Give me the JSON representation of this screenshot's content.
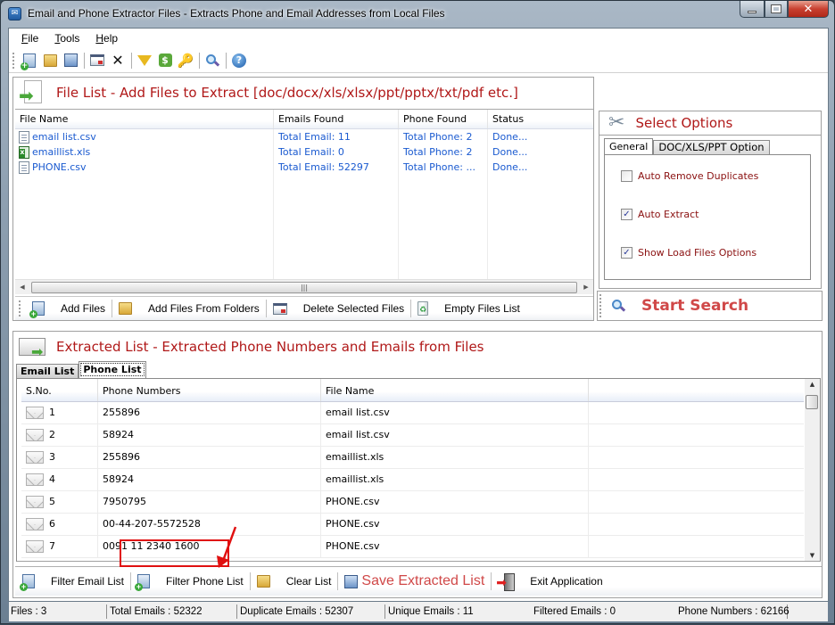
{
  "window": {
    "title": "Email and Phone Extractor Files  -  Extracts Phone and Email Addresses from Local Files",
    "controls": {
      "minimize": "–",
      "maximize": "□",
      "close": "✕"
    }
  },
  "menu": [
    {
      "label": "File",
      "mnemonic": "F"
    },
    {
      "label": "Tools",
      "mnemonic": "T"
    },
    {
      "label": "Help",
      "mnemonic": "H"
    }
  ],
  "toolbar": [
    {
      "icon": "add-files-icon"
    },
    {
      "icon": "add-folder-icon"
    },
    {
      "icon": "save-icon"
    },
    {
      "icon": "delete-selected-icon"
    },
    {
      "icon": "close-x-icon"
    },
    {
      "icon": "filter-icon"
    },
    {
      "icon": "dollar-icon"
    },
    {
      "icon": "key-icon"
    },
    {
      "icon": "search-icon"
    },
    {
      "icon": "help-icon"
    }
  ],
  "file_list": {
    "title": "File List - Add Files to Extract  [doc/docx/xls/xlsx/ppt/pptx/txt/pdf etc.]",
    "columns": [
      "File Name",
      "Emails Found",
      "Phone Found",
      "Status"
    ],
    "rows": [
      {
        "type": "csv",
        "name": "email list.csv",
        "emails": "Total Email: 11",
        "phones": "Total Phone: 2",
        "status": "Done..."
      },
      {
        "type": "xls",
        "name": "emaillist.xls",
        "emails": "Total Email: 0",
        "phones": "Total Phone: 2",
        "status": "Done..."
      },
      {
        "type": "csv",
        "name": "PHONE.csv",
        "emails": "Total Email: 52297",
        "phones": "Total Phone: ...",
        "status": "Done..."
      }
    ],
    "buttons": {
      "add_files": "Add Files",
      "add_folders": "Add Files From Folders",
      "delete_selected": "Delete Selected Files",
      "empty_list": "Empty Files List"
    }
  },
  "options": {
    "title": "Select Options",
    "tabs": [
      "General",
      "DOC/XLS/PPT Option"
    ],
    "active_tab": "General",
    "checkboxes": [
      {
        "label": "Auto Remove Duplicates",
        "checked": false
      },
      {
        "label": "Auto Extract",
        "checked": true
      },
      {
        "label": "Show Load Files Options",
        "checked": true
      }
    ],
    "start_search": "Start Search"
  },
  "extracted": {
    "title": "Extracted List - Extracted Phone Numbers and Emails from Files",
    "tabs": [
      "Email List",
      "Phone List"
    ],
    "active_tab": "Phone List",
    "columns": [
      "S.No.",
      "Phone Numbers",
      "File Name",
      ""
    ],
    "rows": [
      {
        "sno": "1",
        "phone": "255896",
        "file": "email list.csv"
      },
      {
        "sno": "2",
        "phone": "58924",
        "file": "email list.csv"
      },
      {
        "sno": "3",
        "phone": "255896",
        "file": "emaillist.xls"
      },
      {
        "sno": "4",
        "phone": "58924",
        "file": "emaillist.xls"
      },
      {
        "sno": "5",
        "phone": "7950795",
        "file": "PHONE.csv"
      },
      {
        "sno": "6",
        "phone": "00-44-207-5572528",
        "file": "PHONE.csv"
      },
      {
        "sno": "7",
        "phone": "0091 11 2340 1600",
        "file": "PHONE.csv"
      }
    ],
    "buttons": {
      "filter_email": "Filter Email List",
      "filter_phone": "Filter Phone List",
      "clear_list": "Clear List",
      "save_list": "Save Extracted List",
      "exit": "Exit Application"
    },
    "highlighted_button": "Filter Phone List"
  },
  "status": {
    "files": "Files :  3",
    "total_emails": "Total Emails :  52322",
    "duplicate_emails": "Duplicate Emails :  52307",
    "unique_emails": "Unique Emails :  11",
    "filtered_emails": "Filtered Emails :  0",
    "phone_numbers": "Phone Numbers :   62166"
  },
  "colors": {
    "heading_red": "#b01818",
    "action_red": "#d04848",
    "link_blue": "#1a5ad0",
    "highlight_border": "#e01010"
  }
}
